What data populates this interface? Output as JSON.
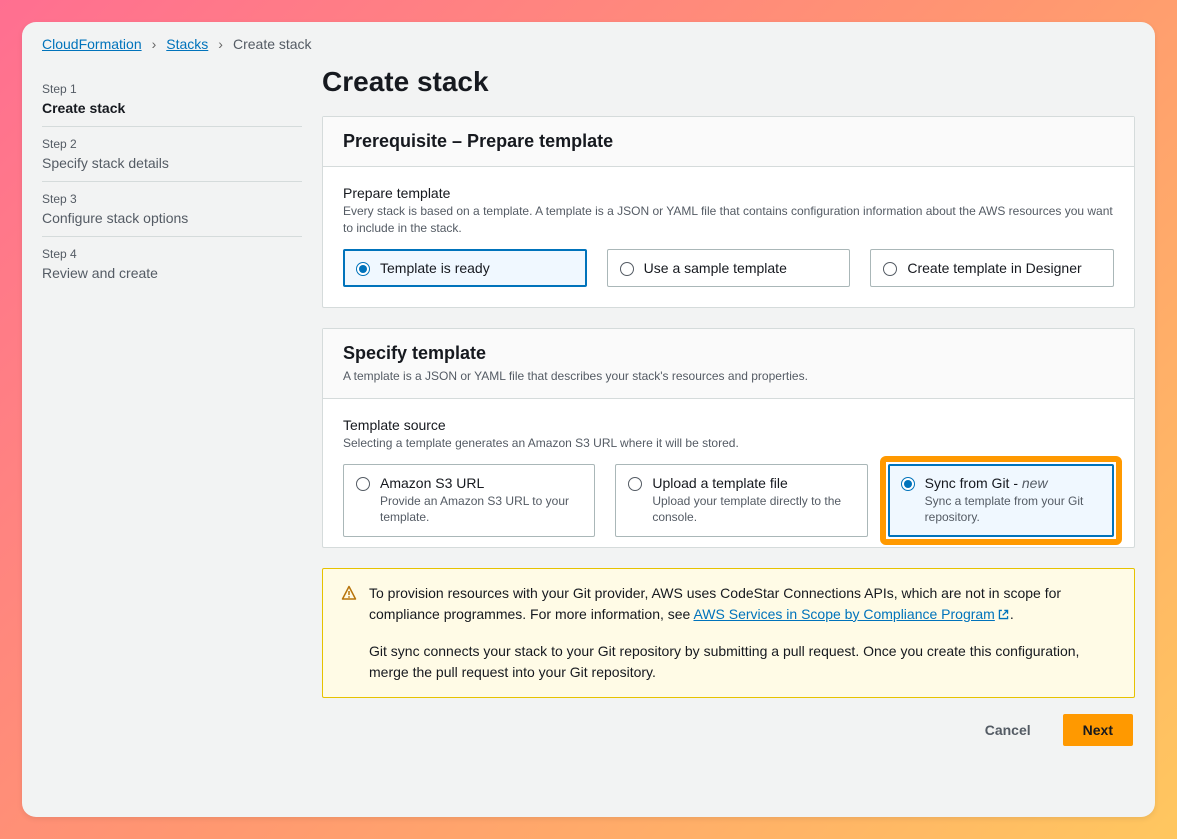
{
  "breadcrumbs": {
    "items": [
      "CloudFormation",
      "Stacks",
      "Create stack"
    ]
  },
  "wizard": {
    "steps": [
      {
        "num": "Step 1",
        "name": "Create stack"
      },
      {
        "num": "Step 2",
        "name": "Specify stack details"
      },
      {
        "num": "Step 3",
        "name": "Configure stack options"
      },
      {
        "num": "Step 4",
        "name": "Review and create"
      }
    ],
    "activeIndex": 0
  },
  "page": {
    "title": "Create stack"
  },
  "panels": {
    "prerequisite": {
      "title": "Prerequisite – Prepare template",
      "field_label": "Prepare template",
      "field_desc": "Every stack is based on a template. A template is a JSON or YAML file that contains configuration information about the AWS resources you want to include in the stack.",
      "options": [
        {
          "label": "Template is ready"
        },
        {
          "label": "Use a sample template"
        },
        {
          "label": "Create template in Designer"
        }
      ],
      "selectedIndex": 0
    },
    "specify": {
      "title": "Specify template",
      "subtitle": "A template is a JSON or YAML file that describes your stack's resources and properties.",
      "field_label": "Template source",
      "field_desc": "Selecting a template generates an Amazon S3 URL where it will be stored.",
      "options": [
        {
          "label": "Amazon S3 URL",
          "sub": "Provide an Amazon S3 URL to your template."
        },
        {
          "label": "Upload a template file",
          "sub": "Upload your template directly to the console."
        },
        {
          "label": "Sync from Git - ",
          "new": "new",
          "sub": "Sync a template from your Git repository."
        }
      ],
      "selectedIndex": 2
    }
  },
  "alert": {
    "p1a": "To provision resources with your Git provider, AWS uses CodeStar Connections APIs, which are not in scope for compliance programmes. For more information, see ",
    "link": "AWS Services in Scope by Compliance Program",
    "p1b": ".",
    "p2": "Git sync connects your stack to your Git repository by submitting a pull request. Once you create this configuration, merge the pull request into your Git repository."
  },
  "buttons": {
    "cancel": "Cancel",
    "next": "Next"
  },
  "icons": {
    "warning": "warning-triangle-icon",
    "external": "external-link-icon"
  },
  "colors": {
    "accent": "#0073bb",
    "primary_button": "#ff9900",
    "highlight": "#ff9900"
  }
}
